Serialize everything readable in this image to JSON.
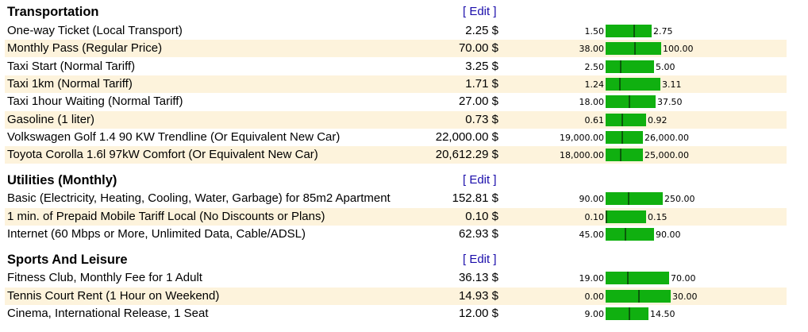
{
  "colors": {
    "row_alt_bg": "#fdf3dc",
    "bar_fill": "#10b010",
    "bar_marker": "#0a5a0a",
    "edit_link": "#1a0dab"
  },
  "sections": [
    {
      "title": "Transportation",
      "edit_label": "[ Edit ]",
      "rows": [
        {
          "label": "One-way Ticket (Local Transport)",
          "price": "2.25 $",
          "min": "1.50",
          "max": "2.75",
          "value": 2.25
        },
        {
          "label": "Monthly Pass (Regular Price)",
          "price": "70.00 $",
          "min": "38.00",
          "max": "100.00",
          "value": 70.0
        },
        {
          "label": "Taxi Start (Normal Tariff)",
          "price": "3.25 $",
          "min": "2.50",
          "max": "5.00",
          "value": 3.25
        },
        {
          "label": "Taxi 1km (Normal Tariff)",
          "price": "1.71 $",
          "min": "1.24",
          "max": "3.11",
          "value": 1.71
        },
        {
          "label": "Taxi 1hour Waiting (Normal Tariff)",
          "price": "27.00 $",
          "min": "18.00",
          "max": "37.50",
          "value": 27.0
        },
        {
          "label": "Gasoline (1 liter)",
          "price": "0.73 $",
          "min": "0.61",
          "max": "0.92",
          "value": 0.73
        },
        {
          "label": "Volkswagen Golf 1.4 90 KW Trendline (Or Equivalent New Car)",
          "price": "22,000.00 $",
          "min": "19,000.00",
          "max": "26,000.00",
          "value": 22000.0
        },
        {
          "label": "Toyota Corolla 1.6l 97kW Comfort (Or Equivalent New Car)",
          "price": "20,612.29 $",
          "min": "18,000.00",
          "max": "25,000.00",
          "value": 20612.29
        }
      ]
    },
    {
      "title": "Utilities (Monthly)",
      "edit_label": "[ Edit ]",
      "rows": [
        {
          "label": "Basic (Electricity, Heating, Cooling, Water, Garbage) for 85m2 Apartment",
          "price": "152.81 $",
          "min": "90.00",
          "max": "250.00",
          "value": 152.81
        },
        {
          "label": "1 min. of Prepaid Mobile Tariff Local (No Discounts or Plans)",
          "price": "0.10 $",
          "min": "0.10",
          "max": "0.15",
          "value": 0.1
        },
        {
          "label": "Internet (60 Mbps or More, Unlimited Data, Cable/ADSL)",
          "price": "62.93 $",
          "min": "45.00",
          "max": "90.00",
          "value": 62.93
        }
      ]
    },
    {
      "title": "Sports And Leisure",
      "edit_label": "[ Edit ]",
      "rows": [
        {
          "label": "Fitness Club, Monthly Fee for 1 Adult",
          "price": "36.13 $",
          "min": "19.00",
          "max": "70.00",
          "value": 36.13
        },
        {
          "label": "Tennis Court Rent (1 Hour on Weekend)",
          "price": "14.93 $",
          "min": "0.00",
          "max": "30.00",
          "value": 14.93
        },
        {
          "label": "Cinema, International Release, 1 Seat",
          "price": "12.00 $",
          "min": "9.00",
          "max": "14.50",
          "value": 12.0
        }
      ]
    }
  ]
}
